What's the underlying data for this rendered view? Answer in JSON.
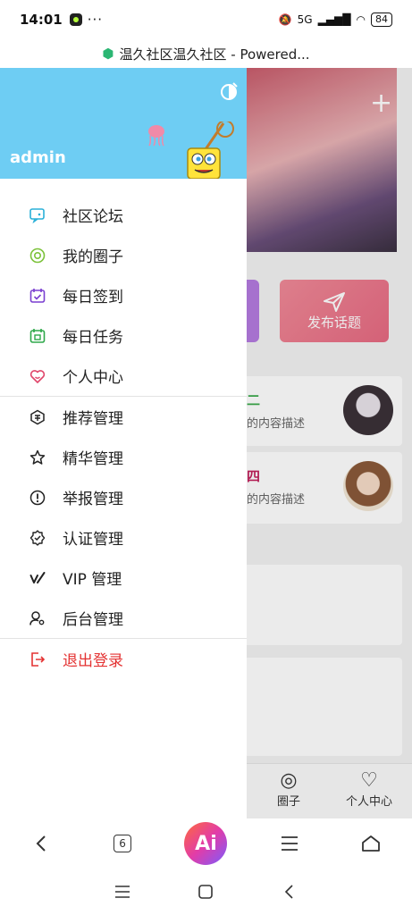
{
  "status": {
    "time": "14:01",
    "dots": "···",
    "network": "5G",
    "battery": "84"
  },
  "browser": {
    "page_title": "温久社区温久社区 - Powered..."
  },
  "background": {
    "publish_label": "发布话题",
    "card1_title": "二",
    "card1_desc": "的内容描述",
    "card2_title": "四",
    "card2_desc": "的内容描述",
    "tab_circle": "圈子",
    "tab_profile": "个人中心"
  },
  "drawer": {
    "username": "admin",
    "menu_primary": [
      {
        "label": "社区论坛",
        "icon": "forum-icon"
      },
      {
        "label": "我的圈子",
        "icon": "circle-icon"
      },
      {
        "label": "每日签到",
        "icon": "calendar-check-icon"
      },
      {
        "label": "每日任务",
        "icon": "task-icon"
      },
      {
        "label": "个人中心",
        "icon": "heart-user-icon"
      }
    ],
    "menu_admin": [
      {
        "label": "推荐管理",
        "icon": "recommend-icon"
      },
      {
        "label": "精华管理",
        "icon": "star-icon"
      },
      {
        "label": "举报管理",
        "icon": "report-icon"
      },
      {
        "label": "认证管理",
        "icon": "badge-icon"
      },
      {
        "label": "VIP 管理",
        "icon": "vip-icon"
      },
      {
        "label": "后台管理",
        "icon": "admin-icon"
      }
    ],
    "logout_label": "退出登录"
  },
  "browser_bar": {
    "tab_count": "6",
    "ai_label": "Ai"
  },
  "colors": {
    "header_bg": "#6ecdf3",
    "logout": "#e43333",
    "publish_btn": "#e76a82"
  }
}
